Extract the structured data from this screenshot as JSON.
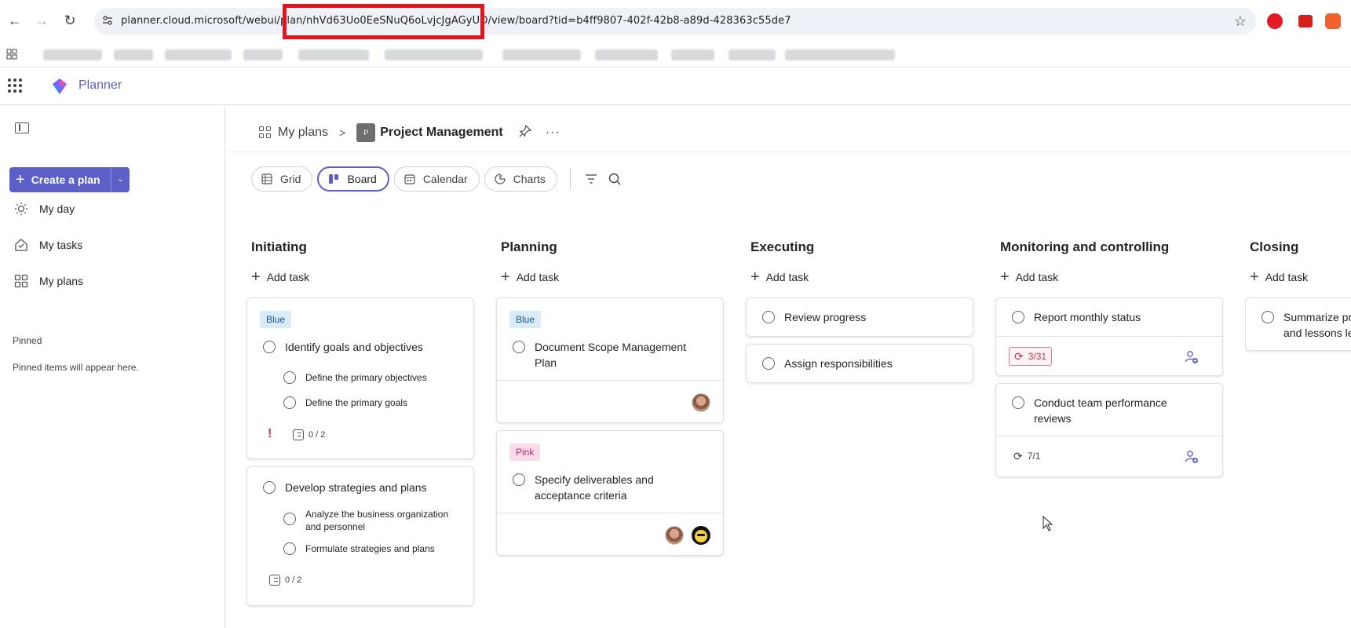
{
  "browser": {
    "url": "planner.cloud.microsoft/webui/plan/nhVd63Uo0EeSNuQ6oLvjcJgAGyUO/view/board?tid=b4ff9807-402f-42b8-a89d-428363c55de7",
    "highlight_color": "#e4141c"
  },
  "app": {
    "name": "Planner",
    "accent": "#5b5fc7"
  },
  "sidebar": {
    "create_label": "Create a plan",
    "items": [
      {
        "label": "My day",
        "icon": "sun-icon"
      },
      {
        "label": "My tasks",
        "icon": "tasks-icon"
      },
      {
        "label": "My plans",
        "icon": "grid-icon"
      }
    ],
    "pinned_heading": "Pinned",
    "pinned_empty": "Pinned items will appear here."
  },
  "header": {
    "breadcrumb_root": "My plans",
    "plan_initial": "P",
    "plan_title": "Project Management"
  },
  "views": {
    "tabs": [
      {
        "label": "Grid",
        "active": false
      },
      {
        "label": "Board",
        "active": true
      },
      {
        "label": "Calendar",
        "active": false
      },
      {
        "label": "Charts",
        "active": false
      }
    ]
  },
  "board": {
    "add_task_label": "Add task",
    "buckets": [
      {
        "title": "Initiating",
        "cards": [
          {
            "label": "Blue",
            "title": "Identify goals and objectives",
            "checklist": [
              "Define the primary objectives",
              "Define the primary goals"
            ],
            "priority": "!",
            "progress": "0 / 2"
          },
          {
            "title": "Develop strategies and plans",
            "checklist": [
              "Analyze the business organization and personnel",
              "Formulate strategies and plans"
            ],
            "progress": "0 / 2"
          }
        ]
      },
      {
        "title": "Planning",
        "cards": [
          {
            "label": "Blue",
            "title": "Document Scope Management Plan"
          },
          {
            "label": "Pink",
            "title": "Specify deliverables and acceptance criteria"
          }
        ]
      },
      {
        "title": "Executing",
        "cards": [
          {
            "title": "Review progress"
          },
          {
            "title": "Assign responsibilities"
          }
        ]
      },
      {
        "title": "Monitoring and controlling",
        "cards": [
          {
            "title": "Report monthly status",
            "due": "3/31"
          },
          {
            "title": "Conduct team performance reviews",
            "due": "7/1"
          }
        ]
      },
      {
        "title": "Closing",
        "cards": [
          {
            "title": "Summarize project and lessons learned"
          }
        ]
      }
    ]
  }
}
